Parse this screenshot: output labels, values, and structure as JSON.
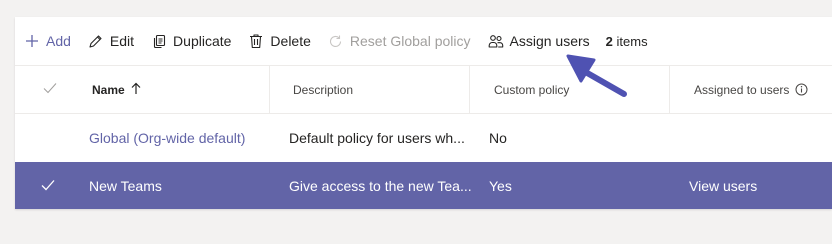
{
  "toolbar": {
    "add_label": "Add",
    "edit_label": "Edit",
    "duplicate_label": "Duplicate",
    "delete_label": "Delete",
    "reset_label": "Reset Global policy",
    "assign_label": "Assign users",
    "count_number": "2",
    "count_suffix": "items"
  },
  "table": {
    "headers": {
      "name": "Name",
      "description": "Description",
      "custom_policy": "Custom policy",
      "assigned_to_users": "Assigned to users"
    },
    "rows": [
      {
        "name": "Global (Org-wide default)",
        "description": "Default policy for users wh...",
        "custom_policy": "No",
        "assigned_to_users": "",
        "selected": false
      },
      {
        "name": "New Teams",
        "description": "Give access to the new Tea...",
        "custom_policy": "Yes",
        "assigned_to_users": "View users",
        "selected": true
      }
    ]
  },
  "colors": {
    "accent": "#6264a7",
    "selected_row": "#6264a7",
    "background": "#f3f2f1",
    "disabled_text": "#a19f9d",
    "annotation_arrow": "#4f52b2"
  },
  "icons": {
    "add": "plus-icon",
    "edit": "pencil-icon",
    "duplicate": "copy-icon",
    "delete": "trash-icon",
    "reset": "refresh-icon",
    "assign": "people-icon",
    "sort": "sort-ascending-icon",
    "info": "info-icon",
    "check": "checkmark-icon",
    "annotation": "pointer-arrow-icon"
  }
}
